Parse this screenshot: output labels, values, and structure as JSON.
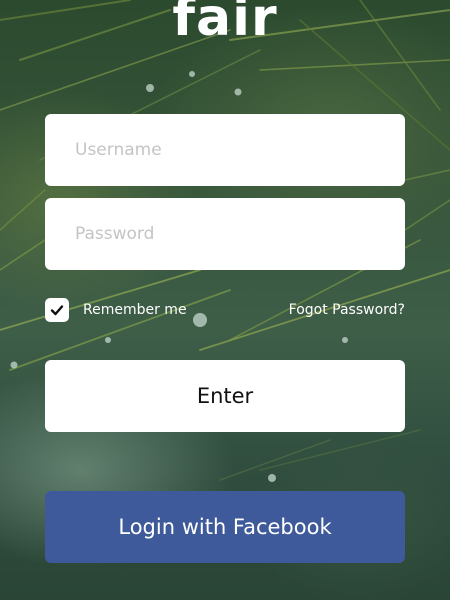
{
  "app": {
    "logo_text": "fair"
  },
  "login_form": {
    "username_placeholder": "Username",
    "password_placeholder": "Password",
    "remember_label": "Remember me",
    "remember_checked": true,
    "forgot_label": "Fogot Password?",
    "enter_label": "Enter",
    "facebook_label": "Login with Facebook"
  },
  "colors": {
    "facebook_button": "#3e5a9a",
    "field_background": "#ffffff",
    "text_light": "#ffffff"
  },
  "icons": {
    "checkbox_mark": "checkmark-icon"
  }
}
